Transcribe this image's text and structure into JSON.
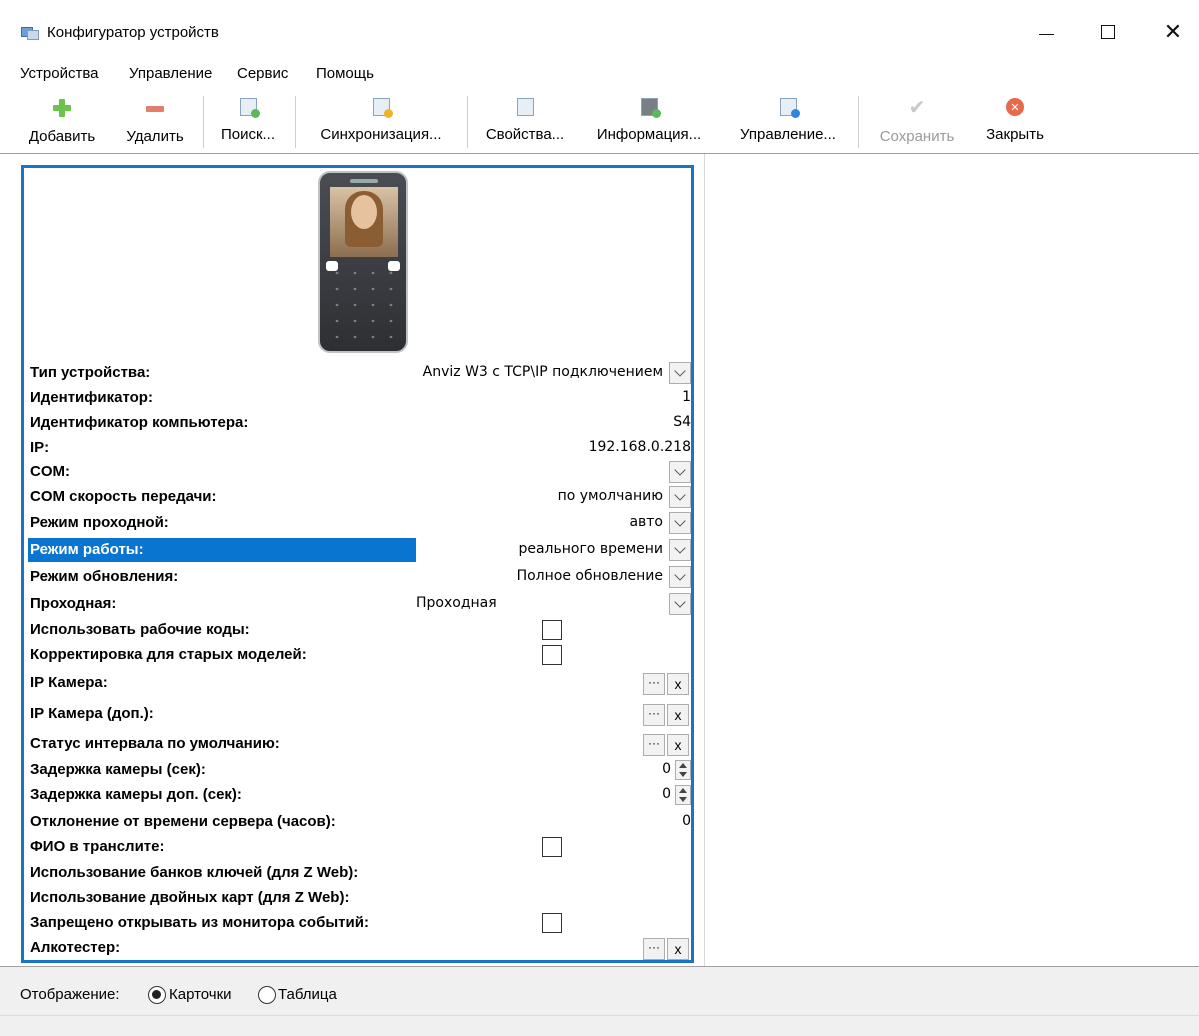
{
  "window": {
    "title": "Конфигуратор устройств"
  },
  "menu": [
    "Устройства",
    "Управление",
    "Сервис",
    "Помощь"
  ],
  "toolbar": {
    "add": "Добавить",
    "delete": "Удалить",
    "search": "Поиск...",
    "sync": "Синхронизация...",
    "properties": "Свойства...",
    "info": "Информация...",
    "manage": "Управление...",
    "save": "Сохранить",
    "close": "Закрыть"
  },
  "properties": {
    "device_type": {
      "label": "Тип устройства:",
      "value": "Anviz W3 с TCP\\IP подключением"
    },
    "identifier": {
      "label": "Идентификатор:",
      "value": "1"
    },
    "computer_id": {
      "label": "Идентификатор компьютера:",
      "value": "S4"
    },
    "ip": {
      "label": "IP:",
      "value": "192.168.0.218"
    },
    "com": {
      "label": "COM:",
      "value": ""
    },
    "com_speed": {
      "label": "COM скорость передачи:",
      "value": "по умолчанию"
    },
    "pass_mode": {
      "label": "Режим проходной:",
      "value": "авто"
    },
    "work_mode": {
      "label": "Режим работы:",
      "value": "реального времени"
    },
    "update_mode": {
      "label": "Режим обновления:",
      "value": "Полное обновление"
    },
    "checkpoint": {
      "label": "Проходная:",
      "value": "Проходная"
    },
    "work_codes": {
      "label": "Использовать рабочие коды:"
    },
    "old_models": {
      "label": "Корректировка для старых моделей:"
    },
    "ip_camera": {
      "label": "IP Камера:"
    },
    "ip_camera_extra": {
      "label": "IP Камера (доп.):"
    },
    "interval_status": {
      "label": "Статус интервала по умолчанию:"
    },
    "camera_delay": {
      "label": "Задержка камеры (сек):",
      "value": "0"
    },
    "camera_delay_extra": {
      "label": "Задержка камеры доп. (сек):",
      "value": "0"
    },
    "server_time_offset": {
      "label": "Отклонение от времени сервера (часов):",
      "value": "0"
    },
    "fio_translit": {
      "label": "ФИО в транслите:"
    },
    "key_banks": {
      "label": "Использование банков ключей (для Z Web):"
    },
    "double_cards": {
      "label": "Использование двойных карт (для Z Web):"
    },
    "no_open_monitor": {
      "label": "Запрещено открывать из монитора событий:"
    },
    "alcotester": {
      "label": "Алкотестер:"
    }
  },
  "buttons": {
    "dots": "···",
    "x": "x"
  },
  "device_image": {
    "brand": "Anviz"
  },
  "display": {
    "label": "Отображение:",
    "options": [
      "Карточки",
      "Таблица"
    ],
    "selected": "Карточки"
  },
  "colors": {
    "selection": "#0a74d1",
    "card_border": "#1a73c9"
  }
}
